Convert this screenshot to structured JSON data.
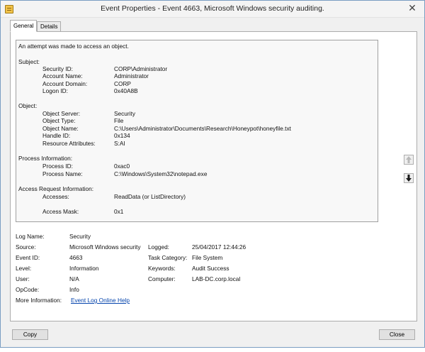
{
  "window": {
    "title": "Event Properties - Event 4663, Microsoft Windows security auditing.",
    "close_glyph": "✕"
  },
  "tabs": [
    {
      "label": "General",
      "active": true
    },
    {
      "label": "Details",
      "active": false
    }
  ],
  "description": {
    "lines": [
      {
        "text": "An attempt was made to access an object.",
        "indent": 0,
        "top": 0,
        "col": "label"
      },
      {
        "text": "Subject:",
        "indent": 0,
        "top": 1,
        "col": "label"
      },
      {
        "text": "Security ID:",
        "value": "CORP\\Administrator",
        "indent": 1
      },
      {
        "text": "Account Name:",
        "value": "Administrator",
        "indent": 1
      },
      {
        "text": "Account Domain:",
        "value": "CORP",
        "indent": 1
      },
      {
        "text": "Logon ID:",
        "value": "0x40A8B",
        "indent": 1
      },
      {
        "text": "Object:",
        "indent": 0
      },
      {
        "text": "Object Server:",
        "value": "Security",
        "indent": 1
      },
      {
        "text": "Object Type:",
        "value": "File",
        "indent": 1
      },
      {
        "text": "Object Name:",
        "value": "C:\\Users\\Administrator\\Documents\\Research\\Honeypot\\honeyfile.txt",
        "indent": 1
      },
      {
        "text": "Handle ID:",
        "value": "0x134",
        "indent": 1
      },
      {
        "text": "Resource Attributes:",
        "value": "S:AI",
        "indent": 1
      },
      {
        "text": "Process Information:",
        "indent": 0
      },
      {
        "text": "Process ID:",
        "value": "0xac0",
        "indent": 1
      },
      {
        "text": "Process Name:",
        "value": "C:\\Windows\\System32\\notepad.exe",
        "indent": 1
      },
      {
        "text": "Access Request Information:",
        "indent": 0
      },
      {
        "text": "Accesses:",
        "value": "ReadData (or ListDirectory)",
        "indent": 1
      },
      {
        "text": "Access Mask:",
        "value": "0x1",
        "indent": 1
      }
    ]
  },
  "details": {
    "log_name_label": "Log Name:",
    "log_name_value": "Security",
    "source_label": "Source:",
    "source_value": "Microsoft Windows security",
    "logged_label": "Logged:",
    "logged_value": "25/04/2017 12:44:26",
    "event_id_label": "Event ID:",
    "event_id_value": "4663",
    "task_category_label": "Task Category:",
    "task_category_value": "File System",
    "level_label": "Level:",
    "level_value": "Information",
    "keywords_label": "Keywords:",
    "keywords_value": "Audit Success",
    "user_label": "User:",
    "user_value": "N/A",
    "computer_label": "Computer:",
    "computer_value": "LAB-DC.corp.local",
    "opcode_label": "OpCode:",
    "opcode_value": "Info",
    "more_info_label": "More Information:",
    "more_info_link": "Event Log Online Help"
  },
  "buttons": {
    "copy": "Copy",
    "close": "Close"
  },
  "colors": {
    "link": "#0645ad",
    "window_border": "#7a9ec2"
  },
  "icons": {
    "scroll_up": "arrow-up-icon",
    "scroll_down": "arrow-down-icon",
    "app": "event-viewer-icon"
  }
}
